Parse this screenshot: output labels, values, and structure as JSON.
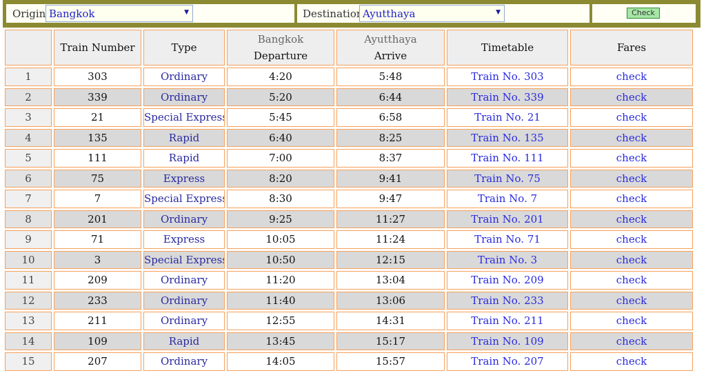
{
  "search": {
    "origin_label": "Origin",
    "origin_value": "Bangkok",
    "destination_label": "Destination",
    "destination_value": "Ayutthaya",
    "check_label": "Check"
  },
  "table": {
    "headers": {
      "train_number": "Train Number",
      "type": "Type",
      "origin_place": "Bangkok",
      "departure": "Departure",
      "dest_place": "Ayutthaya",
      "arrive": "Arrive",
      "timetable": "Timetable",
      "fares": "Fares"
    },
    "rows": [
      {
        "idx": "1",
        "train": "303",
        "type": "Ordinary",
        "dep": "4:20",
        "arr": "5:48",
        "timetable": "Train No. 303",
        "fare": "check"
      },
      {
        "idx": "2",
        "train": "339",
        "type": "Ordinary",
        "dep": "5:20",
        "arr": "6:44",
        "timetable": "Train No. 339",
        "fare": "check"
      },
      {
        "idx": "3",
        "train": "21",
        "type": "Special Express",
        "dep": "5:45",
        "arr": "6:58",
        "timetable": "Train No. 21",
        "fare": "check"
      },
      {
        "idx": "4",
        "train": "135",
        "type": "Rapid",
        "dep": "6:40",
        "arr": "8:25",
        "timetable": "Train No. 135",
        "fare": "check"
      },
      {
        "idx": "5",
        "train": "111",
        "type": "Rapid",
        "dep": "7:00",
        "arr": "8:37",
        "timetable": "Train No. 111",
        "fare": "check"
      },
      {
        "idx": "6",
        "train": "75",
        "type": "Express",
        "dep": "8:20",
        "arr": "9:41",
        "timetable": "Train No. 75",
        "fare": "check"
      },
      {
        "idx": "7",
        "train": "7",
        "type": "Special Express",
        "dep": "8:30",
        "arr": "9:47",
        "timetable": "Train No. 7",
        "fare": "check"
      },
      {
        "idx": "8",
        "train": "201",
        "type": "Ordinary",
        "dep": "9:25",
        "arr": "11:27",
        "timetable": "Train No. 201",
        "fare": "check"
      },
      {
        "idx": "9",
        "train": "71",
        "type": "Express",
        "dep": "10:05",
        "arr": "11:24",
        "timetable": "Train No. 71",
        "fare": "check"
      },
      {
        "idx": "10",
        "train": "3",
        "type": "Special Express",
        "dep": "10:50",
        "arr": "12:15",
        "timetable": "Train No. 3",
        "fare": "check"
      },
      {
        "idx": "11",
        "train": "209",
        "type": "Ordinary",
        "dep": "11:20",
        "arr": "13:04",
        "timetable": "Train No. 209",
        "fare": "check"
      },
      {
        "idx": "12",
        "train": "233",
        "type": "Ordinary",
        "dep": "11:40",
        "arr": "13:06",
        "timetable": "Train No. 233",
        "fare": "check"
      },
      {
        "idx": "13",
        "train": "211",
        "type": "Ordinary",
        "dep": "12:55",
        "arr": "14:31",
        "timetable": "Train No. 211",
        "fare": "check"
      },
      {
        "idx": "14",
        "train": "109",
        "type": "Rapid",
        "dep": "13:45",
        "arr": "15:17",
        "timetable": "Train No. 109",
        "fare": "check"
      },
      {
        "idx": "15",
        "train": "207",
        "type": "Ordinary",
        "dep": "14:05",
        "arr": "15:57",
        "timetable": "Train No. 207",
        "fare": "check"
      }
    ]
  },
  "colors": {
    "bar": "#8b8a32",
    "cell_border": "#f5a05a",
    "link": "#2a2ae0",
    "type_text": "#2a2aa0",
    "check_button": "#a6e6a6"
  }
}
